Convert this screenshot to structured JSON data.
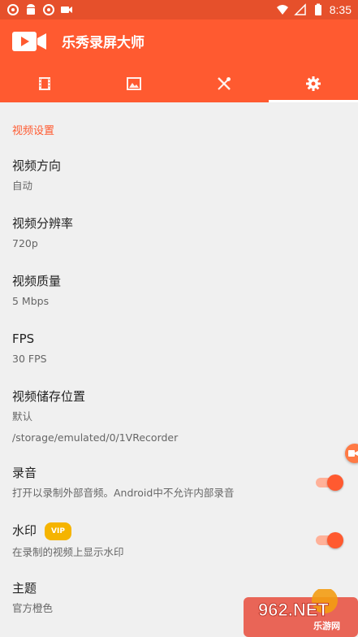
{
  "status_bar": {
    "time": "8:35",
    "left_icons": [
      "sync-icon",
      "android-icon",
      "sync-icon",
      "video-camera-icon"
    ],
    "right_icons": [
      "wifi-icon",
      "signal-icon",
      "battery-icon"
    ]
  },
  "app_bar": {
    "title": "乐秀录屏大师",
    "logo": "video-camera-icon",
    "accent_color": "#ff5a30",
    "tabs": [
      {
        "icon": "film-icon",
        "active": false
      },
      {
        "icon": "image-icon",
        "active": false
      },
      {
        "icon": "tools-icon",
        "active": false
      },
      {
        "icon": "gear-icon",
        "active": true
      }
    ]
  },
  "settings": {
    "section_title": "视频设置",
    "items": [
      {
        "title": "视频方向",
        "subtitle": "自动"
      },
      {
        "title": "视频分辨率",
        "subtitle": "720p"
      },
      {
        "title": "视频质量",
        "subtitle": "5 Mbps"
      },
      {
        "title": "FPS",
        "subtitle": "30 FPS"
      },
      {
        "title": "视频储存位置",
        "subtitle": "默认",
        "subtitle2": "/storage/emulated/0/1VRecorder"
      },
      {
        "title": "录音",
        "subtitle": "打开以录制外部音频。Android中不允许内部录音",
        "toggle": true
      },
      {
        "title": "水印",
        "badge": "VIP",
        "subtitle": "在录制的视频上显示水印",
        "toggle": true
      },
      {
        "title": "主题",
        "subtitle": "官方橙色"
      }
    ]
  },
  "watermark": {
    "text": "962.NET",
    "sub": "乐游网"
  }
}
